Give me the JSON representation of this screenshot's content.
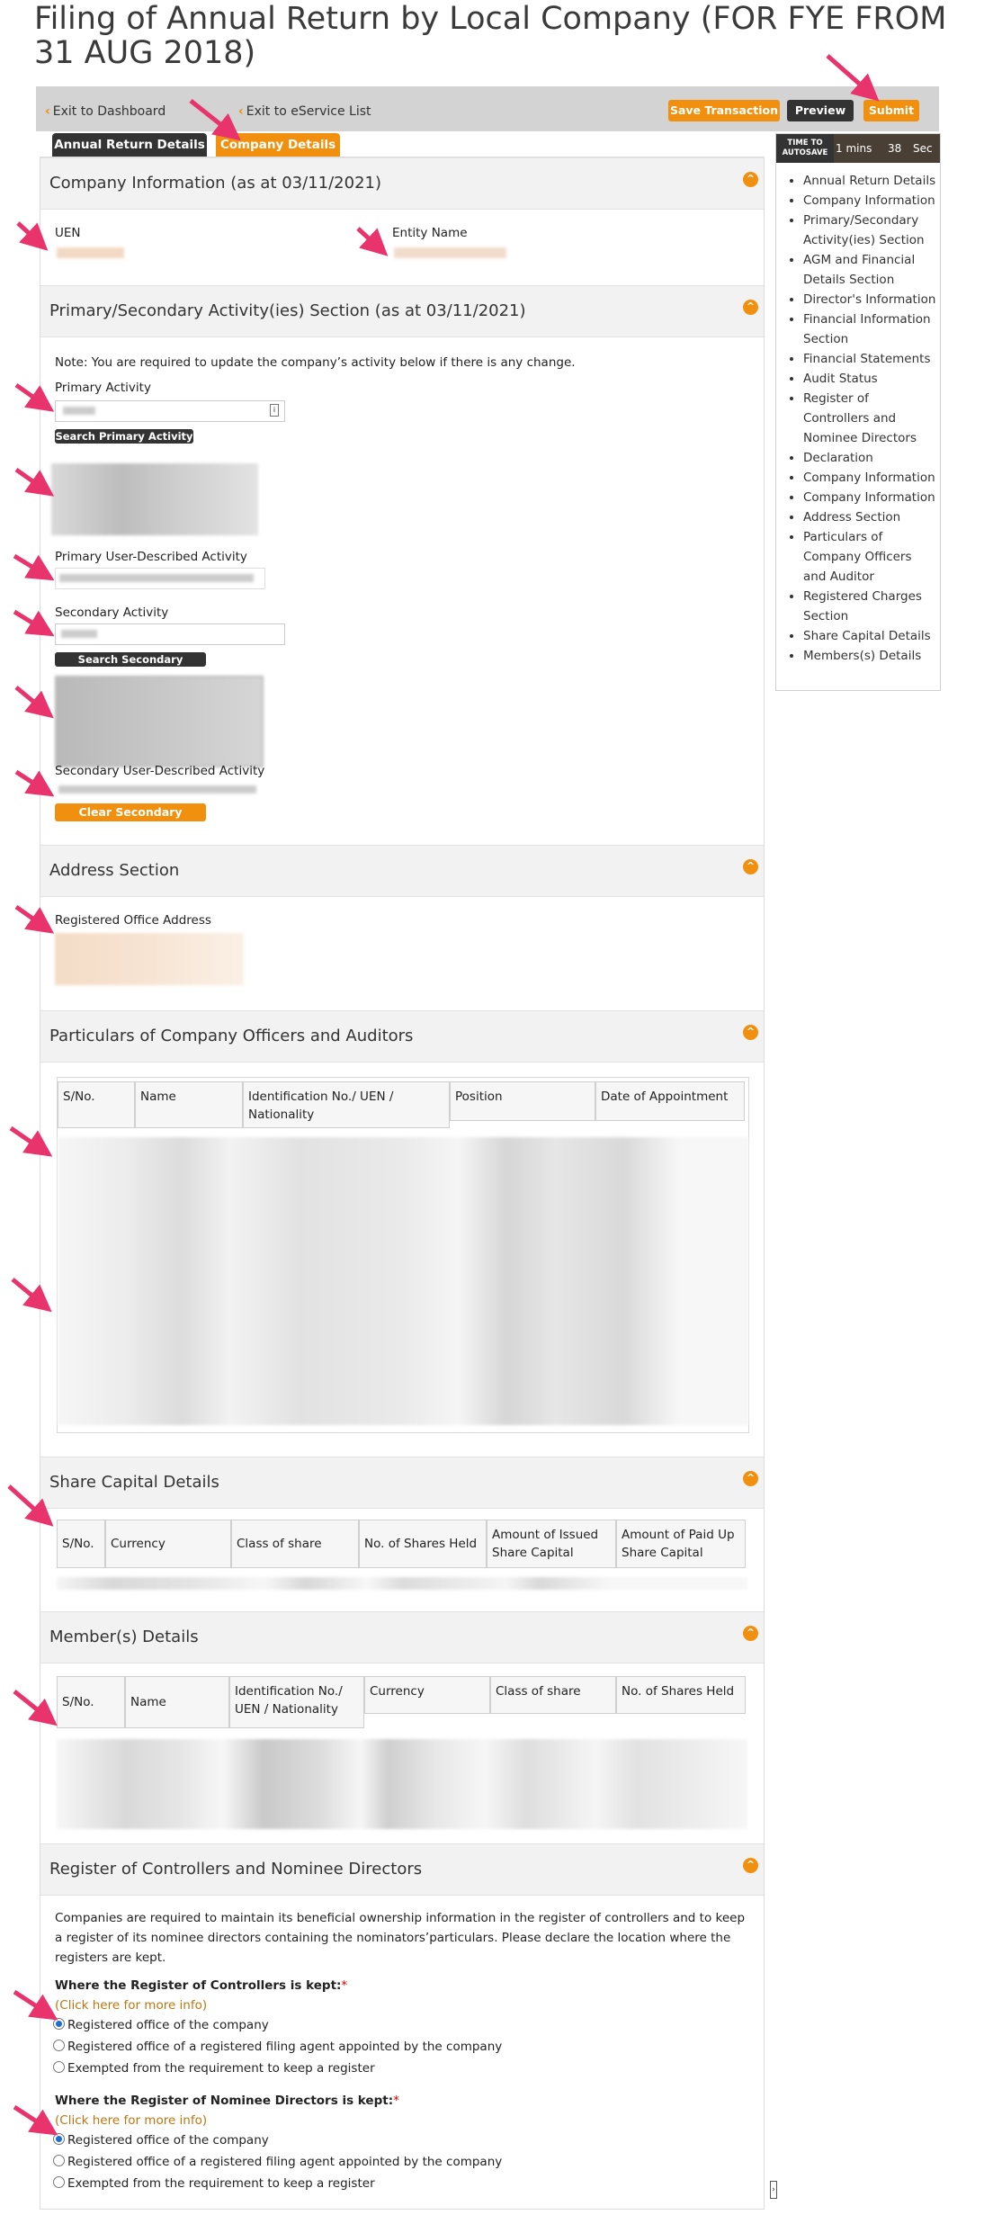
{
  "page": {
    "title": "Filing of Annual Return by Local Company (FOR FYE FROM 31 AUG 2018)"
  },
  "toolbar": {
    "exit_dashboard": "Exit to Dashboard",
    "exit_eservice": "Exit to eService List",
    "save": "Save Transaction",
    "preview": "Preview",
    "submit": "Submit"
  },
  "tabs": [
    {
      "label": "Annual Return Details",
      "active": false
    },
    {
      "label": "Company Details",
      "active": true
    }
  ],
  "autosave": {
    "label_top": "TIME TO",
    "label_bottom": "AUTOSAVE",
    "mins": "1 mins",
    "secs": "38",
    "sec_label": "Sec"
  },
  "sidebar": {
    "items": [
      "Annual Return Details",
      "Company Information",
      "Primary/Secondary Activity(ies) Section",
      "AGM and Financial Details Section",
      "Director's Information",
      "Financial Information Section",
      "Financial Statements",
      "Audit Status",
      "Register of Controllers and Nominee Directors",
      "Declaration",
      "Company Information",
      "Company Information",
      "Address Section",
      "Particulars of Company Officers and Auditor",
      "Registered Charges Section",
      "Share Capital Details",
      "Members(s) Details"
    ]
  },
  "company_info": {
    "title": "Company Information (as at 03/11/2021)",
    "uen_label": "UEN",
    "entity_name_label": "Entity Name"
  },
  "activity": {
    "title": "Primary/Secondary Activity(ies) Section (as at 03/11/2021)",
    "note": "Note: You are required to update the company’s activity below if there is any change.",
    "primary_label": "Primary Activity",
    "search_primary": "Search Primary Activity",
    "primary_user_label": "Primary User-Described Activity",
    "secondary_label": "Secondary Activity",
    "search_secondary": "Search Secondary Activity",
    "secondary_user_label": "Secondary User-Described Activity",
    "clear_secondary": "Clear Secondary Activity"
  },
  "address": {
    "title": "Address Section",
    "reg_office_label": "Registered Office Address"
  },
  "officers": {
    "title": "Particulars of Company Officers and Auditors",
    "columns": [
      "S/No.",
      "Name",
      "Identification No./ UEN / Nationality",
      "Position",
      "Date of Appointment"
    ]
  },
  "share_capital": {
    "title": "Share Capital Details",
    "columns": [
      "S/No.",
      "Currency",
      "Class of share",
      "No. of Shares Held",
      "Amount of Issued Share Capital",
      "Amount of Paid Up Share Capital"
    ]
  },
  "members": {
    "title": "Member(s) Details",
    "columns": [
      "S/No.",
      "Name",
      "Identification No./ UEN / Nationality",
      "Currency",
      "Class of share",
      "No. of Shares Held"
    ]
  },
  "register": {
    "title": "Register of Controllers and Nominee Directors",
    "paragraph": "Companies are required to maintain its beneficial ownership information in the register of controllers and to keep a register of its nominee directors containing the nominators’particulars. Please declare the location where the registers are kept.",
    "q1": "Where the Register of Controllers is kept:",
    "q2": "Where the Register of Nominee Directors is kept:",
    "required": "*",
    "more_info": "(Click here for more info)",
    "options": [
      "Registered office of the company",
      "Registered office of a registered filing agent appointed by the company",
      "Exempted from the requirement to keep a register"
    ],
    "q1_selected": "Registered office of the company",
    "q2_selected": "Registered office of the company"
  },
  "colors": {
    "accent": "#f0900e",
    "arrow": "#e8336d",
    "dark": "#333333"
  }
}
